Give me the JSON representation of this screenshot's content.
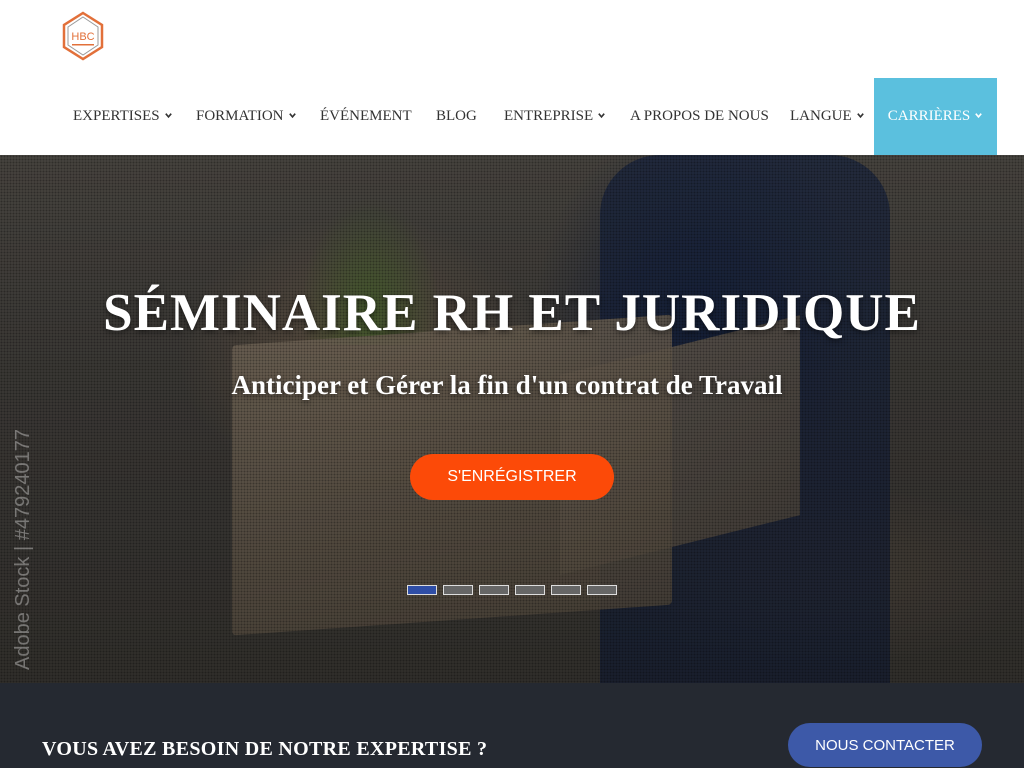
{
  "header": {
    "logo_text": "HBC",
    "nav": [
      {
        "label": "EXPERTISES",
        "has_dropdown": true
      },
      {
        "label": "FORMATION",
        "has_dropdown": true
      },
      {
        "label": "ÉVÉNEMENT",
        "has_dropdown": false
      },
      {
        "label": "BLOG",
        "has_dropdown": false
      },
      {
        "label": "ENTREPRISE",
        "has_dropdown": true
      },
      {
        "label": "A PROPOS DE NOUS",
        "has_dropdown": false
      },
      {
        "label": "LANGUE",
        "has_dropdown": true
      },
      {
        "label": "CARRIÈRES",
        "has_dropdown": true,
        "active": true
      }
    ]
  },
  "hero": {
    "title": "SÉMINAIRE RH ET JURIDIQUE",
    "subtitle": "Anticiper et Gérer la fin d'un contrat de Travail",
    "cta_label": "S'ENRÉGISTRER",
    "watermark": "Adobe Stock | #479240177",
    "slide_count": 6,
    "active_slide": 1
  },
  "band": {
    "title": "VOUS AVEZ BESOIN DE NOTRE EXPERTISE ?",
    "contact_label": "NOUS CONTACTER"
  },
  "colors": {
    "active_nav_bg": "#5bc0de",
    "cta_bg": "#fc4a08",
    "indicator_active": "#2f4ea6",
    "band_bg": "#252931",
    "contact_bg": "#3d59a8"
  }
}
